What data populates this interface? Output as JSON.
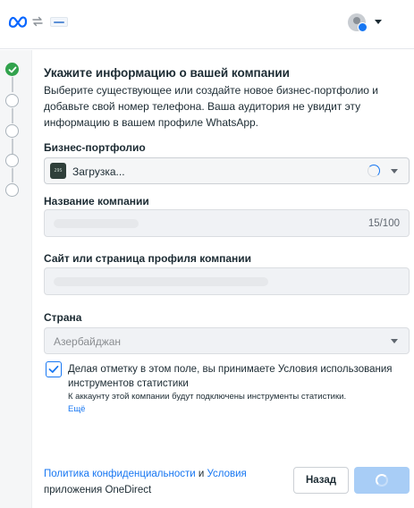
{
  "header": {
    "meta_logo": "meta-logo",
    "swap": "swap-icon",
    "app_logo": "app-logo",
    "account_avatar": "avatar",
    "account_badge": "facebook-badge"
  },
  "stepper": {
    "steps": [
      {
        "state": "completed"
      },
      {
        "state": "pending"
      },
      {
        "state": "pending"
      },
      {
        "state": "pending"
      },
      {
        "state": "pending"
      }
    ]
  },
  "form": {
    "heading": "Укажите информацию о вашей компании",
    "description": "Выберите существующее или создайте новое бизнес-портфолио и добавьте свой номер телефона. Ваша аудитория не увидит эту информацию в вашем профиле WhatsApp.",
    "portfolio": {
      "label": "Бизнес-портфолио",
      "thumbnail_text": "29S",
      "value": "Загрузка..."
    },
    "company_name": {
      "label": "Название компании",
      "counter": "15/100"
    },
    "website": {
      "label": "Сайт или страница профиля компании"
    },
    "country": {
      "label": "Страна",
      "value": "Азербайджан"
    },
    "consent": {
      "checked": true,
      "text": "Делая отметку в этом поле, вы принимаете Условия использования инструментов статистики",
      "note": "К аккаунту этой компании будут подключены инструменты статистики.",
      "more": "Ещё"
    }
  },
  "footer": {
    "privacy_link": "Политика конфиденциальности",
    "and": " и ",
    "terms_link": "Условия",
    "terms_suffix": "приложения OneDirect",
    "back_button": "Назад"
  },
  "colors": {
    "accent": "#1877f2",
    "success": "#31a24c",
    "next_disabled": "#a8cdf6"
  }
}
